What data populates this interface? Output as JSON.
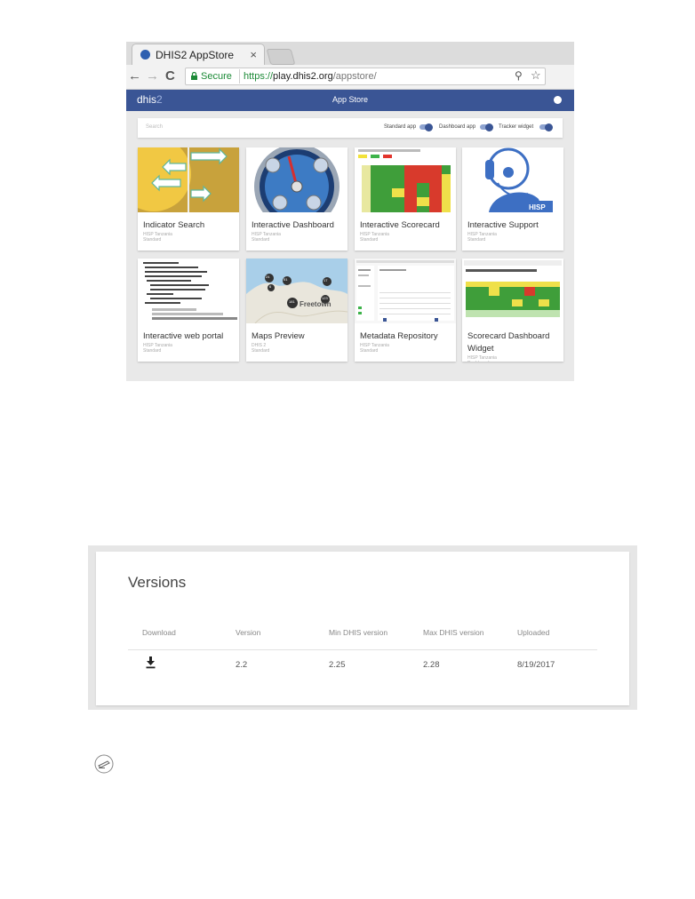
{
  "browser": {
    "tab_title": "DHIS2 AppStore",
    "tab_close": "×",
    "nav_back": "←",
    "nav_forward": "→",
    "nav_reload": "C",
    "secure_label": "Secure",
    "url_proto": "https://",
    "url_host": "play.dhis2.org",
    "url_path": "/appstore/",
    "zoom_icon": "magnifier-icon",
    "bookmark_icon": "star-icon"
  },
  "appbar": {
    "logo_prefix": "dhis",
    "logo_suffix": "2",
    "title": "App Store",
    "color": "#3a5595"
  },
  "filters": {
    "search_placeholder": "Search",
    "toggles": [
      {
        "label": "Standard app",
        "on": true
      },
      {
        "label": "Dashboard app",
        "on": true
      },
      {
        "label": "Tracker widget",
        "on": true
      }
    ]
  },
  "apps": [
    {
      "name": "Indicator Search",
      "developer": "HISP Tanzania",
      "type": "Standard"
    },
    {
      "name": "Interactive Dashboard",
      "developer": "HISP Tanzania",
      "type": "Standard"
    },
    {
      "name": "Interactive Scorecard",
      "developer": "HISP Tanzania",
      "type": "Standard"
    },
    {
      "name": "Interactive Support",
      "developer": "HISP Tanzania",
      "type": "Standard"
    },
    {
      "name": "Interactive web portal",
      "developer": "HISP Tanzania",
      "type": "Standard"
    },
    {
      "name": "Maps Preview",
      "developer": "DHIS 2",
      "type": "Standard",
      "map_label": "Freetown",
      "map_counts": [
        "24",
        "51",
        "17",
        "6",
        "181",
        "123"
      ]
    },
    {
      "name": "Metadata Repository",
      "developer": "HISP Tanzania",
      "type": "Standard"
    },
    {
      "name": "Scorecard Dashboard Widget",
      "developer": "HISP Tanzania",
      "type": "Dashboard"
    }
  ],
  "versions": {
    "title": "Versions",
    "columns": [
      "Download",
      "Version",
      "Min DHIS version",
      "Max DHIS version",
      "Uploaded"
    ],
    "rows": [
      {
        "version": "2.2",
        "min": "2.25",
        "max": "2.28",
        "uploaded": "8/19/2017"
      }
    ]
  }
}
